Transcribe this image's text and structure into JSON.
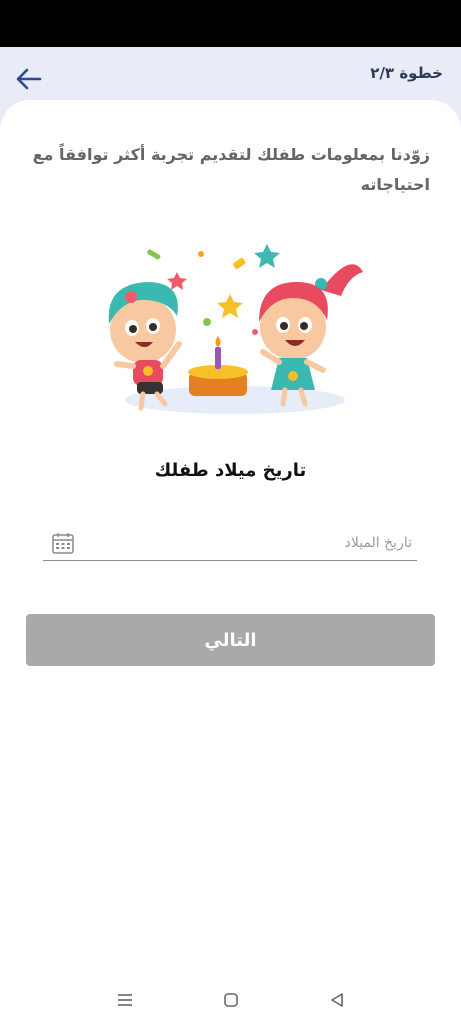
{
  "header": {
    "step_label": "خطوة ٢/٣"
  },
  "content": {
    "subtitle": "زوّدنا بمعلومات طفلك لتقديم تجربة أكثر توافقاً مع احتياجاته",
    "section_title": "تاريخ ميلاد طفلك",
    "date_field": {
      "value": "",
      "placeholder": "تاريخ الميلاد"
    },
    "next_button_label": "التالي"
  },
  "icons": {
    "back": "arrow-left-icon",
    "calendar": "calendar-icon",
    "nav_menu": "menu-icon",
    "nav_home": "square-icon",
    "nav_back": "triangle-back-icon"
  },
  "colors": {
    "header_bg": "#e9ebf6",
    "back_arrow": "#2c4a8c",
    "button_disabled": "#a9a9a9"
  }
}
